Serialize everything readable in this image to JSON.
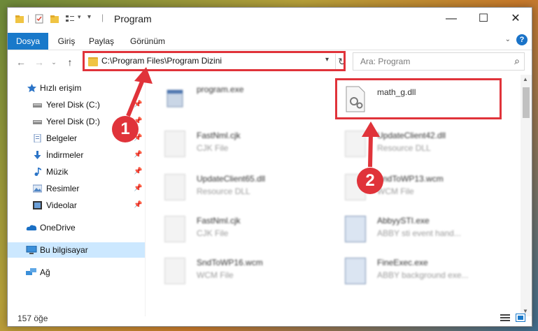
{
  "window": {
    "title": "Program"
  },
  "ribbon": {
    "tabs": [
      {
        "label": "Dosya"
      },
      {
        "label": "Giriş"
      },
      {
        "label": "Paylaş"
      },
      {
        "label": "Görünüm"
      }
    ],
    "active_tab_index": 0,
    "help_label": "?"
  },
  "address": {
    "path": "C:\\Program Files\\Program Dizini"
  },
  "search": {
    "placeholder": "Ara: Program"
  },
  "sidebar": {
    "items": [
      {
        "label": "Hızlı erişim",
        "icon": "star-icon",
        "pinned": false
      },
      {
        "label": "Yerel Disk (C:)",
        "icon": "drive-icon",
        "pinned": true
      },
      {
        "label": "Yerel Disk (D:)",
        "icon": "drive-icon",
        "pinned": true
      },
      {
        "label": "Belgeler",
        "icon": "documents-icon",
        "pinned": true
      },
      {
        "label": "İndirmeler",
        "icon": "download-icon",
        "pinned": true
      },
      {
        "label": "Müzik",
        "icon": "music-icon",
        "pinned": true
      },
      {
        "label": "Resimler",
        "icon": "pictures-icon",
        "pinned": true
      },
      {
        "label": "Videolar",
        "icon": "videos-icon",
        "pinned": true
      },
      {
        "label": "OneDrive",
        "icon": "cloud-icon",
        "pinned": false
      },
      {
        "label": "Bu bilgisayar",
        "icon": "computer-icon",
        "pinned": false,
        "selected": true
      },
      {
        "label": "Ağ",
        "icon": "network-icon",
        "pinned": false
      }
    ]
  },
  "files": [
    {
      "name": "program.exe",
      "desc": "",
      "blurred": true
    },
    {
      "name": "math_g.dll",
      "desc": "",
      "blurred": false,
      "highlighted": true
    },
    {
      "name": "FastNml.cjk",
      "desc": "CJK File",
      "blurred": true
    },
    {
      "name": "UpdateClient42.dll",
      "desc": "Resource DLL",
      "blurred": true
    },
    {
      "name": "UpdateClient65.dll",
      "desc": "Resource DLL",
      "blurred": true
    },
    {
      "name": "SndToWP13.wcm",
      "desc": "WCM File",
      "blurred": true
    },
    {
      "name": "FastNml.cjk",
      "desc": "CJK File",
      "blurred": true
    },
    {
      "name": "AbbyySTI.exe",
      "desc": "ABBY sti event hand...",
      "blurred": true
    },
    {
      "name": "SndToWP16.wcm",
      "desc": "WCM File",
      "blurred": true
    },
    {
      "name": "FineExec.exe",
      "desc": "ABBY background exe...",
      "blurred": true
    }
  ],
  "status": {
    "item_count": "157 öğe"
  },
  "callouts": [
    {
      "label": "1"
    },
    {
      "label": "2"
    }
  ],
  "colors": {
    "accent": "#1979ca",
    "highlight": "#e0333a",
    "selection": "#cce8ff"
  }
}
